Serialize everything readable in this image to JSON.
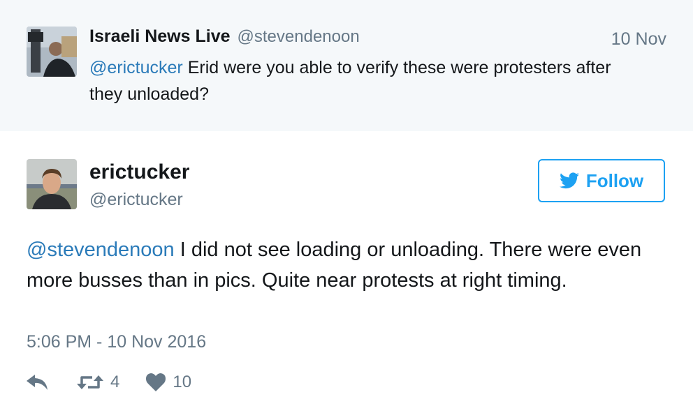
{
  "parent_tweet": {
    "avatar_icon": "user-avatar-icon",
    "display_name": "Israeli News Live",
    "handle": "@stevendenoon",
    "date": "10 Nov",
    "mention": "@erictucker",
    "text": " Erid were you able to verify these were protesters after they unloaded?"
  },
  "tweet": {
    "avatar_icon": "user-avatar-icon",
    "display_name": "erictucker",
    "handle": "@erictucker",
    "follow_label": "Follow",
    "follow_icon": "twitter-bird-icon",
    "mention": "@stevendenoon",
    "text": " I did not see loading or unloading. There were even more busses than in pics. Quite near protests at right timing.",
    "timestamp": "5:06 PM - 10 Nov 2016",
    "actions": {
      "reply_icon": "reply-icon",
      "retweet_icon": "retweet-icon",
      "retweet_count": "4",
      "like_icon": "heart-icon",
      "like_count": "10"
    }
  },
  "colors": {
    "accent": "#1da1f2",
    "link": "#2b7bb9",
    "muted": "#657786",
    "text": "#14171a",
    "parent_background": "#f5f8fa"
  }
}
